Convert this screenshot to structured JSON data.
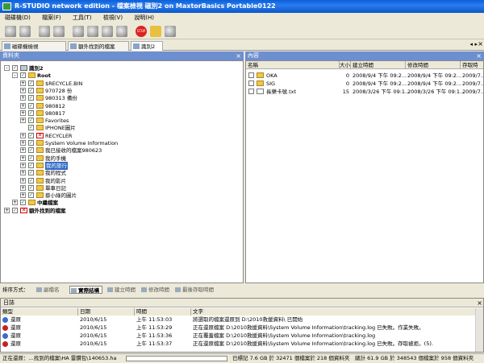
{
  "window": {
    "title": "R-STUDIO network edition - 檔案檢視 磁別2 on MaxtorBasics Portable0122"
  },
  "menu": [
    "磁碟機(D)",
    "檔案(F)",
    "工具(T)",
    "檢視(V)",
    "說明(H)"
  ],
  "toolbar_stop_label": "STOP",
  "tabs": [
    {
      "label": "磁碟機檢視"
    },
    {
      "label": "額外找到的檔案"
    },
    {
      "label": "識別2"
    }
  ],
  "left_panel": {
    "title": "資料夾",
    "tree": [
      {
        "label": "識別2",
        "depth": 0,
        "expander": "-",
        "icon": "drive",
        "bold": true
      },
      {
        "label": "Root",
        "depth": 1,
        "expander": "-",
        "icon": "folder",
        "bold": true
      },
      {
        "label": "$RECYCLE.BIN",
        "depth": 2,
        "expander": "+",
        "icon": "folder"
      },
      {
        "label": "970728 份",
        "depth": 2,
        "expander": "+",
        "icon": "folder"
      },
      {
        "label": "980313 備份",
        "depth": 2,
        "expander": "+",
        "icon": "folder"
      },
      {
        "label": "980812",
        "depth": 2,
        "expander": "+",
        "icon": "folder"
      },
      {
        "label": "980817",
        "depth": 2,
        "expander": "+",
        "icon": "folder"
      },
      {
        "label": "Favorites",
        "depth": 2,
        "expander": "+",
        "icon": "folder"
      },
      {
        "label": "IPHONE圖片",
        "depth": 2,
        "expander": "",
        "icon": "folder"
      },
      {
        "label": "RECYCLER",
        "depth": 2,
        "expander": "+",
        "icon": "xred"
      },
      {
        "label": "System Volume Information",
        "depth": 2,
        "expander": "+",
        "icon": "folder"
      },
      {
        "label": "我已接收的檔案980623",
        "depth": 2,
        "expander": "+",
        "icon": "folder"
      },
      {
        "label": "我的手機",
        "depth": 2,
        "expander": "+",
        "icon": "folder"
      },
      {
        "label": "我的旅行",
        "depth": 2,
        "expander": "+",
        "icon": "folder",
        "selected": true
      },
      {
        "label": "我的程式",
        "depth": 2,
        "expander": "+",
        "icon": "folder"
      },
      {
        "label": "我的影片",
        "depth": 2,
        "expander": "+",
        "icon": "folder"
      },
      {
        "label": "單車日記",
        "depth": 2,
        "expander": "+",
        "icon": "folder"
      },
      {
        "label": "蔡小綠的圖片",
        "depth": 2,
        "expander": "+",
        "icon": "folder"
      },
      {
        "label": "中繼檔案",
        "depth": 1,
        "expander": "+",
        "icon": "folder",
        "bold": true
      },
      {
        "label": "額外找到的檔案",
        "depth": 0,
        "expander": "+",
        "icon": "xred",
        "bold": true
      }
    ]
  },
  "right_panel": {
    "title": "內容",
    "columns": [
      "名稱",
      "大小",
      "建立時間",
      "修改時間",
      "存取時"
    ],
    "files": [
      {
        "name": "OKA",
        "size": "0",
        "created": "2008/9/4 下午 09:2...",
        "modified": "2008/9/4 下午 09:2...",
        "accessed": "2009/7...",
        "icon": "folder"
      },
      {
        "name": "SIG",
        "size": "0",
        "created": "2008/9/4 下午 09:2...",
        "modified": "2008/9/4 下午 09:2...",
        "accessed": "2009/7...",
        "icon": "folder"
      },
      {
        "name": "長樂卡號.txt",
        "size": "15",
        "created": "2008/3/26 下午 09:1...",
        "modified": "2008/3/26 下午 09:1...",
        "accessed": "2009/7...",
        "icon": "file"
      }
    ]
  },
  "sortbar": {
    "label": "排序方式：",
    "options": [
      "副檔名",
      "實際結構",
      "建立時間",
      "修改時間",
      "最後存取時間"
    ],
    "active": 1
  },
  "log": {
    "title": "日誌",
    "columns": [
      "類型",
      "日期",
      "時間",
      "文字"
    ],
    "rows": [
      {
        "type": "還原",
        "kind": "info",
        "date": "2010/6/15",
        "time": "上午 11:53:03",
        "text": "將選取的檔案還原到 D:\\2010救援資料\\ 已開始"
      },
      {
        "type": "還原",
        "kind": "err",
        "date": "2010/6/15",
        "time": "上午 11:53:29",
        "text": "正在還原檔案 D:\\2010救援資料\\System Volume Information\\tracking.log 已失敗。作業失敗。"
      },
      {
        "type": "還原",
        "kind": "info",
        "date": "2010/6/15",
        "time": "上午 11:53:36",
        "text": "正在覆蓋檔案 D:\\2010救援資料\\System Volume Information\\tracking.log"
      },
      {
        "type": "還原",
        "kind": "err",
        "date": "2010/6/15",
        "time": "上午 11:53:37",
        "text": "正在還原檔案 D:\\2010救援資料\\System Volume Information\\tracking.log 已失敗。存取被拒。(5)."
      }
    ]
  },
  "status": {
    "left": "正在還原：...找到的檔案\\HA 雷鑽包\\140653.ha",
    "marked": "已標記 7.6 GB 於 32471 個檔案於 218 個資料夾",
    "total": "總計 61.9 GB 於 348543 個檔案於 958 個資料夾",
    "progress": 0.0
  }
}
